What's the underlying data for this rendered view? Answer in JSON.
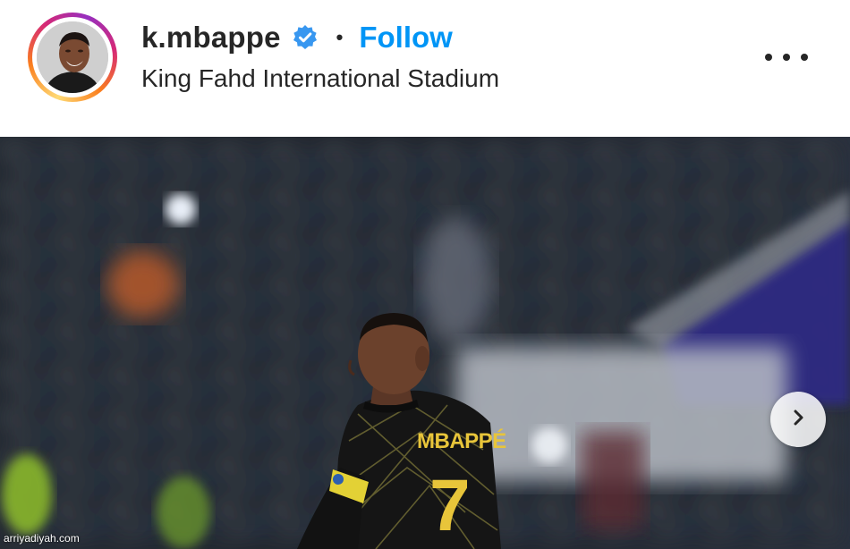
{
  "post_header": {
    "username": "k.mbappe",
    "verified_icon": "verified-badge-icon",
    "separator": "•",
    "follow_label": "Follow",
    "location": "King Fahd International Stadium",
    "more_icon": "more-options-icon"
  },
  "photo": {
    "jersey_name": "MBAPPÉ",
    "jersey_number": "7",
    "next_icon": "chevron-right-icon"
  },
  "watermark": "arriyadiyah.com",
  "colors": {
    "follow_blue": "#0095f6",
    "verified_blue": "#3897f0",
    "text_dark": "#262626",
    "jersey_gold": "#e8c53a"
  }
}
